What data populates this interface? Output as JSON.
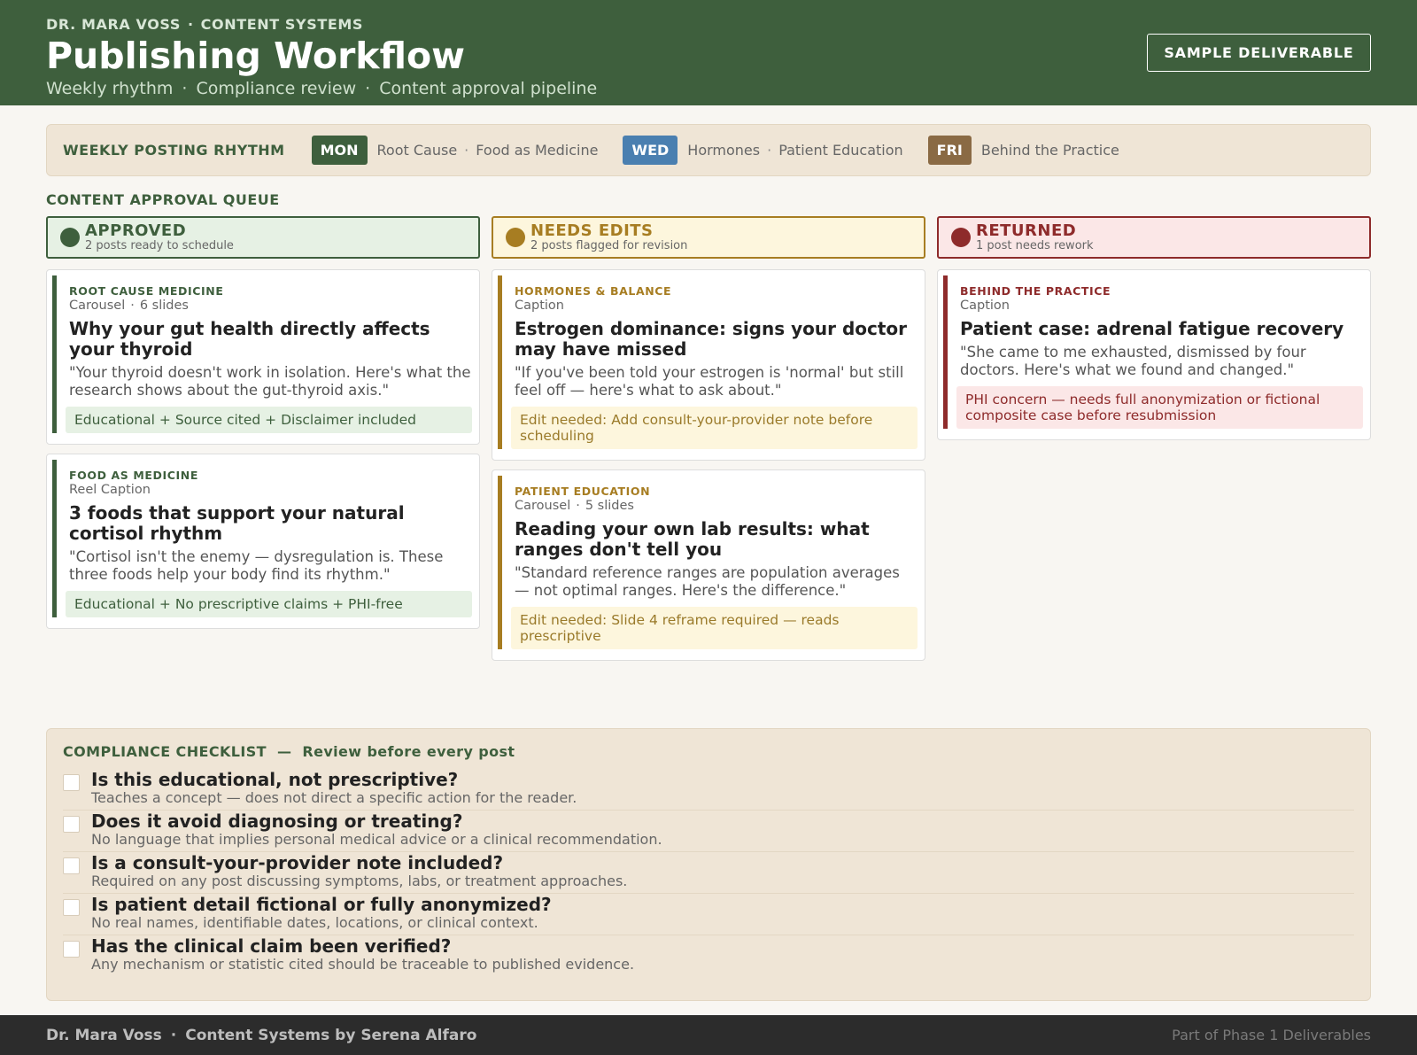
{
  "header": {
    "eyebrow_name": "DR. MARA VOSS",
    "eyebrow_sep": "·",
    "eyebrow_dept": "CONTENT SYSTEMS",
    "title": "Publishing Workflow",
    "subtitle_parts": [
      "Weekly rhythm",
      "Compliance review",
      "Content approval pipeline"
    ],
    "subtitle_sep": "·",
    "badge": "SAMPLE DELIVERABLE"
  },
  "rhythm": {
    "title": "WEEKLY POSTING RHYTHM",
    "days": [
      {
        "day": "MON",
        "color": "#3e5f3d",
        "topics": [
          "Root Cause",
          "Food as Medicine"
        ]
      },
      {
        "day": "WED",
        "color": "#4a7fb0",
        "topics": [
          "Hormones",
          "Patient Education"
        ]
      },
      {
        "day": "FRI",
        "color": "#8a6a44",
        "topics": [
          "Behind the Practice"
        ]
      }
    ],
    "sep": "·"
  },
  "queue": {
    "title": "CONTENT APPROVAL QUEUE",
    "columns": [
      {
        "name": "APPROVED",
        "sub": "2 posts ready to schedule",
        "accent": "#3e5f3d",
        "header_bg": "#e6f1e4",
        "note_bg": "#e6f1e4",
        "note_color": "#3e5f3d",
        "cards": [
          {
            "category": "ROOT CAUSE MEDICINE",
            "format": "Carousel",
            "slides": "6 slides",
            "title": "Why your gut health directly affects your thyroid",
            "quote": "\"Your thyroid doesn't work in isolation. Here's what the research shows about the gut-thyroid axis.\"",
            "note": "Educational + Source cited + Disclaimer included"
          },
          {
            "category": "FOOD AS MEDICINE",
            "format": "Reel Caption",
            "slides": "",
            "title": "3 foods that support your natural cortisol rhythm",
            "quote": "\"Cortisol isn't the enemy — dysregulation is. These three foods help your body find its rhythm.\"",
            "note": "Educational + No prescriptive claims + PHI-free"
          }
        ]
      },
      {
        "name": "NEEDS EDITS",
        "sub": "2 posts flagged for revision",
        "accent": "#a77d22",
        "header_bg": "#fdf6dd",
        "note_bg": "#fdf6dd",
        "note_color": "#9a7a2a",
        "cards": [
          {
            "category": "HORMONES & BALANCE",
            "format": "Caption",
            "slides": "",
            "title": "Estrogen dominance: signs your doctor may have missed",
            "quote": "\"If you've been told your estrogen is 'normal' but still feel off — here's what to ask about.\"",
            "note": "Edit needed: Add consult-your-provider note before scheduling"
          },
          {
            "category": "PATIENT EDUCATION",
            "format": "Carousel",
            "slides": "5 slides",
            "title": "Reading your own lab results: what ranges don't tell you",
            "quote": "\"Standard reference ranges are population averages — not optimal ranges. Here's the difference.\"",
            "note": "Edit needed: Slide 4 reframe required — reads prescriptive"
          }
        ]
      },
      {
        "name": "RETURNED",
        "sub": "1 post needs rework",
        "accent": "#8e2b2b",
        "header_bg": "#fbe7e7",
        "note_bg": "#fbe7e7",
        "note_color": "#8e2b2b",
        "cards": [
          {
            "category": "BEHIND THE PRACTICE",
            "format": "Caption",
            "slides": "",
            "title": "Patient case: adrenal fatigue recovery",
            "quote": "\"She came to me exhausted, dismissed by four doctors. Here's what we found and changed.\"",
            "note": "PHI concern — needs full anonymization or fictional composite case before resubmission"
          }
        ]
      }
    ]
  },
  "checklist": {
    "title": "COMPLIANCE CHECKLIST",
    "dash": "—",
    "subtitle": "Review before every post",
    "items": [
      {
        "q": "Is this educational, not prescriptive?",
        "d": "Teaches a concept — does not direct a specific action for the reader."
      },
      {
        "q": "Does it avoid diagnosing or treating?",
        "d": "No language that implies personal medical advice or a clinical recommendation."
      },
      {
        "q": "Is a consult-your-provider note included?",
        "d": "Required on any post discussing symptoms, labs, or treatment approaches."
      },
      {
        "q": "Is patient detail fictional or fully anonymized?",
        "d": "No real names, identifiable dates, locations, or clinical context."
      },
      {
        "q": "Has the clinical claim been verified?",
        "d": "Any mechanism or statistic cited should be traceable to published evidence."
      }
    ]
  },
  "footer": {
    "name": "Dr. Mara Voss",
    "sep": "·",
    "credit": "Content Systems by Serena Alfaro",
    "right": "Part of Phase 1 Deliverables"
  }
}
